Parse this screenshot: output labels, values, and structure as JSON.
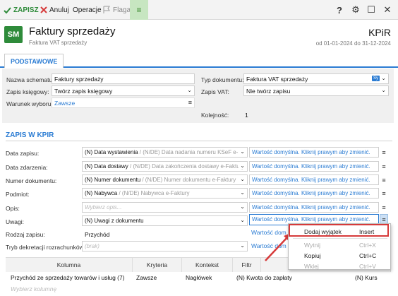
{
  "toolbar": {
    "save": "ZAPISZ",
    "cancel": "Anuluj",
    "operations": "Operacje",
    "flag": "Flaga",
    "menu": "≡",
    "help": "?",
    "settings": "⚙",
    "maximize": "☐",
    "close": "✕"
  },
  "header": {
    "badge": "SM",
    "title": "Faktury sprzedaży",
    "subtitle": "Faktura VAT sprzedaży",
    "book": "KPiR",
    "period": "od 01-01-2024 do 31-12-2024"
  },
  "tabs": {
    "basic": "PODSTAWOWE"
  },
  "basic": {
    "schema_name_label": "Nazwa schematu:",
    "schema_name_value": "Faktury sprzedaży",
    "posting_label": "Zapis księgowy:",
    "posting_value": "Twórz zapis księgowy",
    "condition_label": "Warunek wyboru:",
    "condition_value": "Zawsze",
    "doc_type_label": "Typ dokumentu:",
    "doc_type_value": "Faktura VAT sprzedaży",
    "doc_type_badge": "Sy",
    "vat_label": "Zapis VAT:",
    "vat_value": "Nie twórz zapisu",
    "order_label": "Kolejność:",
    "order_value": "1"
  },
  "kpir_section": {
    "title": "ZAPIS W KPIR",
    "default_text": "Wartość domyślna. Kliknij prawym aby zmienić.",
    "rows": [
      {
        "label": "Data zapisu:",
        "main": "(N) Data wystawienia",
        "extra": " / (N/DE) Data nadania numeru KSeF e-F"
      },
      {
        "label": "Data zdarzenia:",
        "main": "(N) Data dostawy",
        "extra": " / (N/DE) Data zakończenia dostawy e-Faktury"
      },
      {
        "label": "Numer dokumentu:",
        "main": "(N) Numer dokumentu",
        "extra": " / (N/DE) Numer dokumentu e-Faktury"
      },
      {
        "label": "Podmiot:",
        "main": "(N) Nabywca",
        "extra": " / (N/DE) Nabywca e-Faktury"
      },
      {
        "label": "Opis:",
        "main": "",
        "extra": "Wybierz opis..."
      },
      {
        "label": "Uwagi:",
        "main": "(N) Uwagi z dokumentu",
        "extra": ""
      }
    ],
    "record_type_label": "Rodzaj zapisu:",
    "record_type_value": "Przychód",
    "record_type_default": "Wartość dom",
    "decree_label": "Tryb dekretacji rozrachunków:",
    "decree_value": "(brak)",
    "decree_default": "Wartość dom"
  },
  "grid": {
    "headers": [
      "Kolumna",
      "Kryteria",
      "Kontekst",
      "Filtr"
    ],
    "row": [
      "Przychód ze sprzedaży towarów i usług (7)",
      "Zawsze",
      "Nagłówek",
      "(N) Kwota do zapłaty",
      "(N) Kurs"
    ],
    "new_placeholder": "Wybierz kolumnę"
  },
  "context_menu": {
    "items": [
      {
        "label": "Dodaj wyjątek",
        "shortcut": "Insert"
      },
      {
        "label": "Wytnij",
        "shortcut": "Ctrl+X"
      },
      {
        "label": "Kopiuj",
        "shortcut": "Ctrl+C"
      },
      {
        "label": "Wklej",
        "shortcut": "Ctrl+V"
      }
    ]
  },
  "colors": {
    "accent": "#2b7cd3",
    "brand": "#2e8b3a",
    "highlight": "#d63a3a"
  }
}
